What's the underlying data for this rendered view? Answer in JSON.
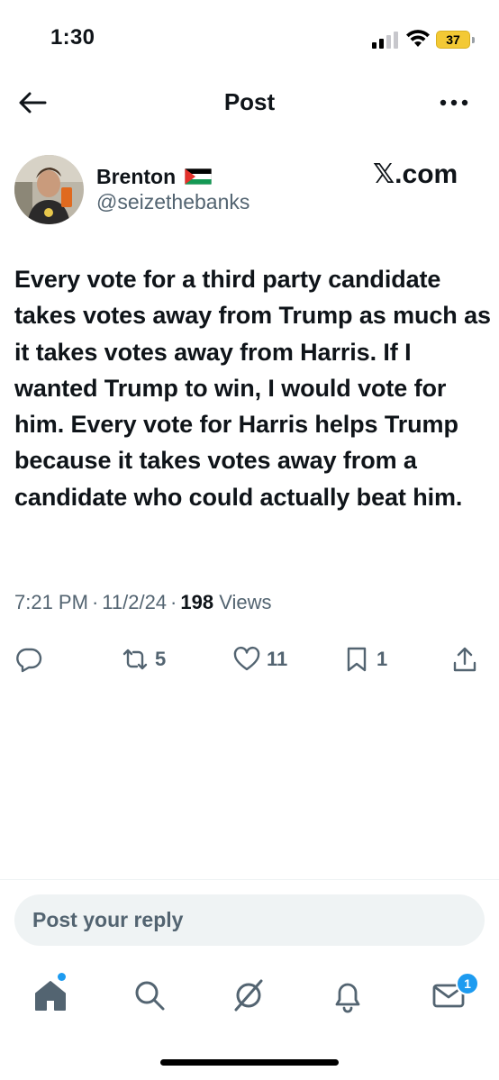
{
  "status_bar": {
    "time": "1:30",
    "battery": "37",
    "battery_color": "#f3c935"
  },
  "header": {
    "title": "Post",
    "back_icon": "arrow-left-icon",
    "more_icon": "more-dots-icon"
  },
  "post": {
    "display_name": "Brenton",
    "flag_icon": "palestine-flag-icon",
    "handle": "@seizethebanks",
    "watermark": "𝕏.com",
    "text": "Every vote for a third party candidate takes votes away from Trump as much as it takes votes away from Harris. If I wanted Trump to win, I would vote for him. Every vote for Harris helps Trump because it takes votes away from a candidate who could actually beat him.",
    "time": "7:21 PM",
    "date": "11/2/24",
    "views_count": "198",
    "views_label": "Views"
  },
  "actions": {
    "reply_icon": "reply-icon",
    "repost_count": "5",
    "like_count": "11",
    "bookmark_count": "1",
    "share_icon": "share-icon"
  },
  "reply": {
    "placeholder": "Post your reply"
  },
  "tabbar": {
    "items": [
      "home-icon",
      "search-icon",
      "grok-icon",
      "notifications-icon",
      "messages-icon"
    ],
    "messages_badge": "1",
    "accent": "#1d9bf0"
  },
  "colors": {
    "text": "#0f1419",
    "secondary": "#536471",
    "accent": "#1d9bf0"
  }
}
